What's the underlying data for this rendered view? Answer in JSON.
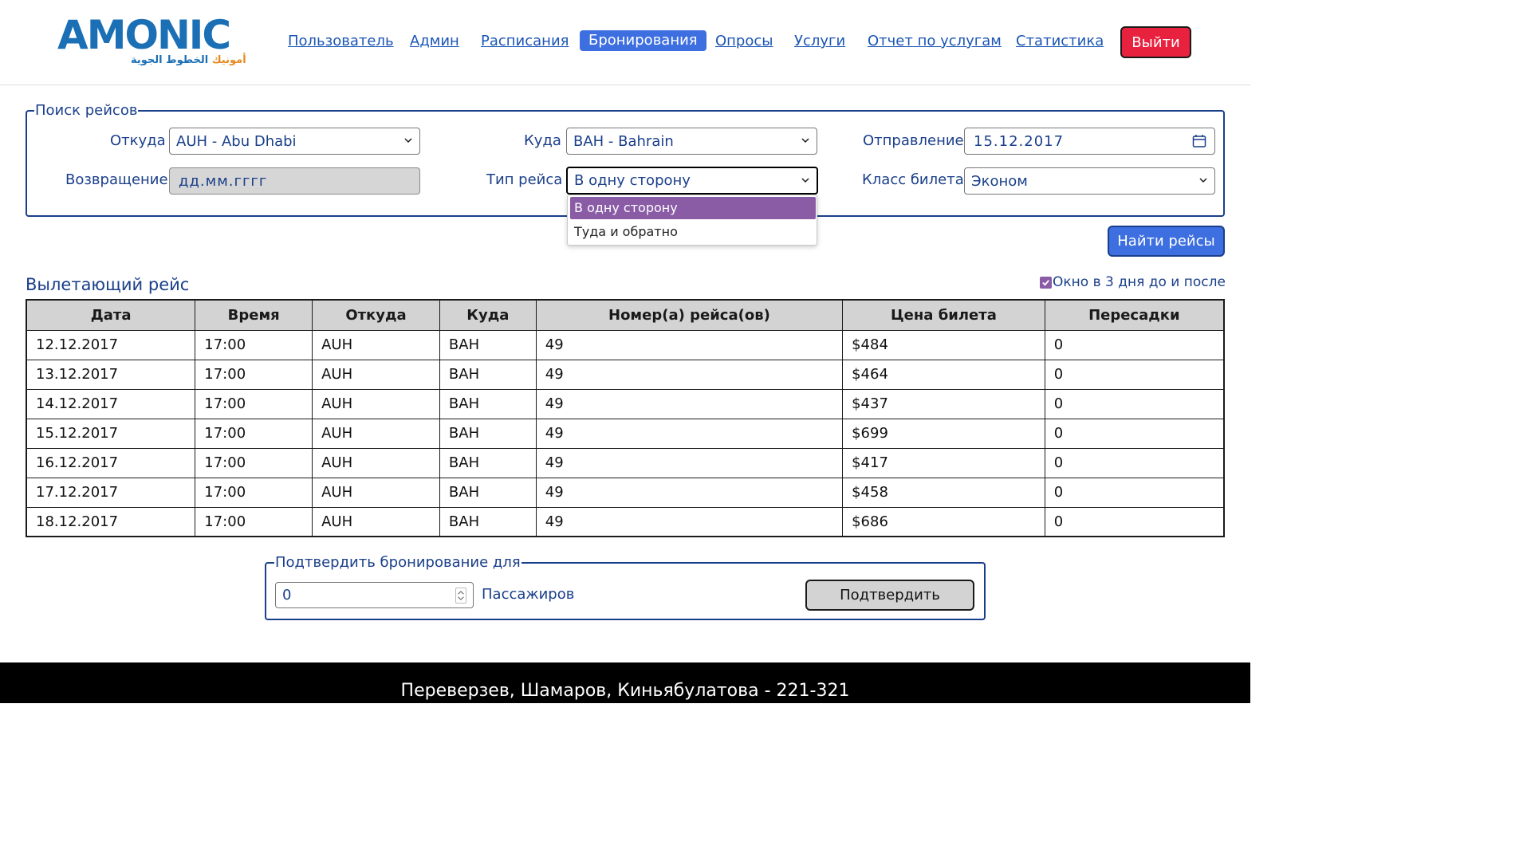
{
  "header": {
    "logo_text": "AMONIC",
    "logo_arabic_part1": "أمونيك",
    "logo_arabic_part2": "الخطوط الجوية",
    "nav": [
      {
        "label": "Пользователь",
        "active": false
      },
      {
        "label": "Админ",
        "active": false
      },
      {
        "label": "Расписания",
        "active": false
      },
      {
        "label": "Бронирования",
        "active": true
      },
      {
        "label": "Опросы",
        "active": false
      },
      {
        "label": "Услуги",
        "active": false
      },
      {
        "label": "Отчет по услугам",
        "active": false
      },
      {
        "label": "Статистика",
        "active": false
      }
    ],
    "logout_label": "Выйти"
  },
  "search": {
    "legend": "Поиск рейсов",
    "from_label": "Откуда",
    "from_value": "AUH - Abu Dhabi",
    "to_label": "Куда",
    "to_value": "BAH - Bahrain",
    "depart_label": "Отправление",
    "depart_value": "15.12.2017",
    "return_label": "Возвращение",
    "return_placeholder": "дд.мм.гггг",
    "trip_type_label": "Тип рейса",
    "trip_type_value": "В одну сторону",
    "trip_type_options": [
      "В одну сторону",
      "Туда и обратно"
    ],
    "class_label": "Класс билета",
    "class_value": "Эконом",
    "search_button": "Найти рейсы"
  },
  "results": {
    "title": "Вылетающий рейс",
    "window_checkbox_label": "Окно в 3 дня до и после",
    "window_checkbox_checked": true,
    "columns": [
      "Дата",
      "Время",
      "Откуда",
      "Куда",
      "Номер(а) рейса(ов)",
      "Цена билета",
      "Пересадки"
    ],
    "rows": [
      [
        "12.12.2017",
        "17:00",
        "AUH",
        "BAH",
        "49",
        "$484",
        "0"
      ],
      [
        "13.12.2017",
        "17:00",
        "AUH",
        "BAH",
        "49",
        "$464",
        "0"
      ],
      [
        "14.12.2017",
        "17:00",
        "AUH",
        "BAH",
        "49",
        "$437",
        "0"
      ],
      [
        "15.12.2017",
        "17:00",
        "AUH",
        "BAH",
        "49",
        "$699",
        "0"
      ],
      [
        "16.12.2017",
        "17:00",
        "AUH",
        "BAH",
        "49",
        "$417",
        "0"
      ],
      [
        "17.12.2017",
        "17:00",
        "AUH",
        "BAH",
        "49",
        "$458",
        "0"
      ],
      [
        "18.12.2017",
        "17:00",
        "AUH",
        "BAH",
        "49",
        "$686",
        "0"
      ]
    ]
  },
  "confirm": {
    "legend": "Подтвердить бронирование для",
    "passengers_value": "0",
    "passengers_label": "Пассажиров",
    "confirm_button": "Подтвердить"
  },
  "footer": {
    "text": "Переверзев, Шамаров, Киньябулатова - 221-321"
  },
  "colors": {
    "primary": "#3d6fe0",
    "label": "#1a3f8a",
    "logout": "#e8213f",
    "highlight": "#8a5ca6"
  }
}
